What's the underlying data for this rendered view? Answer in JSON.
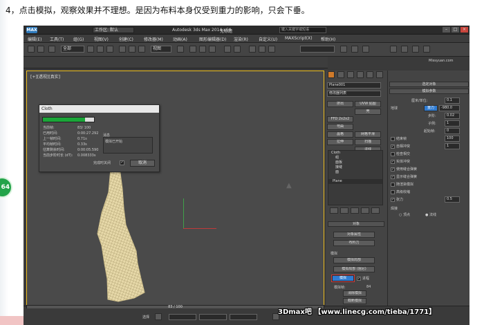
{
  "caption": "4，点击模拟，观察效果并不理想。是因为布料本身仅受到重力的影响，只会下垂。",
  "badge": "64",
  "window": {
    "app_logo": "MAX",
    "title": "Autodesk 3ds Max  2014 x64",
    "document": "无标题",
    "workspace": "工作区: 默认",
    "search_placeholder": "键入关键字或短语"
  },
  "menus": [
    "编辑(E)",
    "工具(T)",
    "组(G)",
    "视图(V)",
    "创建(C)",
    "修改器(M)",
    "动画(A)",
    "图形编辑器(D)",
    "渲染(R)",
    "自定义(U)",
    "MAXScript(X)",
    "帮助(H)"
  ],
  "toolbar": {
    "selection_filter": "全部",
    "view_dropdown": "视图"
  },
  "viewport": {
    "label": "[+][透视][真实]"
  },
  "cloth_dialog": {
    "title": "Cloth",
    "progress": 0.83,
    "stats": [
      {
        "label": "当前帧:",
        "value": "83/ 100"
      },
      {
        "label": "已用时间:",
        "value": "0:00:27.292"
      },
      {
        "label": "上一帧时间:",
        "value": "0.71s"
      },
      {
        "label": "平均帧时间:",
        "value": "0.33s"
      },
      {
        "label": "估算剩余时间:",
        "value": "0:00:05.590"
      },
      {
        "label": "当前步阶时长 (dT):",
        "value": "0.008333s"
      }
    ],
    "message_label": "消息",
    "message": "模拟已开始",
    "close_on_done": "完成时关闭",
    "cancel": "取消"
  },
  "command_panel": {
    "object_name": "Plane001",
    "modifier_list": "修改器列表",
    "buttons": [
      "挤出",
      "UVW 贴图",
      "壳",
      "FFD 2x2x2",
      "弯曲",
      "晶格",
      "拉伸",
      "网格平滑",
      "扫描",
      "法线"
    ],
    "stack": {
      "cloth": "Cloth",
      "subitems": [
        "组",
        "面板",
        "接缝",
        "面"
      ],
      "base": "Plane"
    },
    "object_rollout": "对象",
    "object_props": "对象属性",
    "cloth_forces": "布料力",
    "sim_label": "模拟",
    "sim_local": "模拟局部",
    "sim_local_damped": "模拟局部 (阻尼)",
    "simulate": "模拟",
    "progress_label": "进程",
    "sim_frame_label": "模拟帧:",
    "sim_frame": "84",
    "erase_sim": "消除模拟",
    "truncate_sim": "截断模拟"
  },
  "sim_params": {
    "select_object": "选定对象",
    "rollout_title": "模拟参数",
    "unit_label": "厘米/单位:",
    "unit_value": "0.1",
    "earth": "地球",
    "gravity": "重力",
    "gravity_value": "-980.0",
    "step_label": "步阶:",
    "step_value": "0.02",
    "subsample_label": "子例:",
    "subsample_value": "1",
    "start_frame_label": "起始帧:",
    "start_frame_value": "0",
    "end_frame": "结束帧",
    "end_frame_value": "100",
    "self_collision": "自相冲突",
    "self_collision_value": "1",
    "check_intersect": "检查相交",
    "solid_collision": "实体冲突",
    "use_sewing": "使用缝合弹簧",
    "show_sewing": "显示缝合弹簧",
    "sim_on_render": "随渲染模拟",
    "advanced_pinching": "高级收缩",
    "tension": "张力",
    "tension_value": "0.5",
    "weld_label": "焊接",
    "weld_verts": "顶点",
    "weld_normals": "法线"
  },
  "time": {
    "slider": "83 / 100"
  },
  "status": {
    "select_label": "选择",
    "grid": "栅格 = 0.0cm"
  },
  "watermark": "3Dmax吧 【www.linecg.com/tieba/1771】",
  "corner_watermark": "Missyuan.com"
}
